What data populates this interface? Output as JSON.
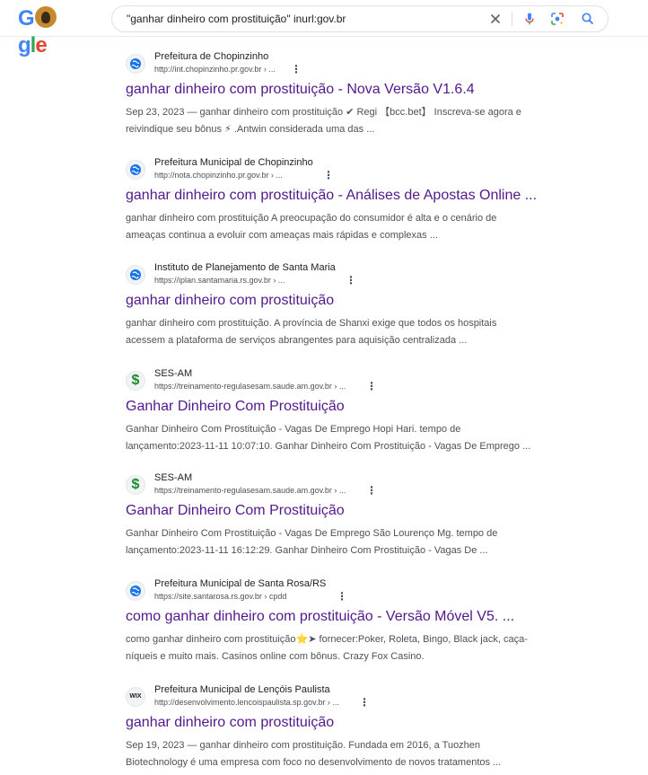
{
  "search": {
    "query": "\"ganhar dinheiro com prostituição\" inurl:gov.br"
  },
  "logo": {
    "text_g1": "G",
    "text_g2": "g",
    "text_l": "l",
    "text_e": "e"
  },
  "icons": {
    "clear": "close-icon",
    "voice": "microphone-icon",
    "lens": "lens-icon",
    "search": "search-icon"
  },
  "colors": {
    "title_link": "#52188c",
    "favicon_globe": "#1a73e8",
    "favicon_dollar": "#198b2c"
  },
  "results": [
    {
      "favicon": "globe",
      "site_name": "Prefeitura de Chopinzinho",
      "url": "http://int.chopinzinho.pr.gov.br › ...",
      "title": "ganhar dinheiro com prostituição - Nova Versão V1.6.4",
      "snippet_line1": "Sep 23, 2023 — ganhar dinheiro com prostituição ✔ Regi 【bcc.bet】 Inscreva-se agora e",
      "snippet_line2": "reivindique seu bônus ⚡ .Antwin considerada uma das ..."
    },
    {
      "favicon": "globe",
      "site_name": "Prefeitura Municipal de Chopinzinho",
      "url": "http://nota.chopinzinho.pr.gov.br › ...",
      "title": "ganhar dinheiro com prostituição - Análises de Apostas Online ...",
      "snippet_line1": "ganhar dinheiro com prostituição A preocupação do consumidor é alta e o cenário de",
      "snippet_line2": "ameaças continua a evoluir com ameaças mais rápidas e complexas ..."
    },
    {
      "favicon": "globe",
      "site_name": "Instituto de Planejamento de Santa Maria",
      "url": "https://iplan.santamaria.rs.gov.br › ...",
      "title": "ganhar dinheiro com prostituição",
      "snippet_line1": "ganhar dinheiro com prostituição. A província de Shanxi exige que todos os hospitais",
      "snippet_line2": "acessem a plataforma de serviços abrangentes para aquisição centralizada ..."
    },
    {
      "favicon": "dollar",
      "site_name": "SES-AM",
      "url": "https://treinamento-regulasesam.saude.am.gov.br › ...",
      "title": "Ganhar Dinheiro Com Prostituição",
      "snippet_line1": "Ganhar Dinheiro Com Prostituição - Vagas De Emprego Hopi Hari. tempo de",
      "snippet_line2": "lançamento:2023-11-11 10:07:10. Ganhar Dinheiro Com Prostituição - Vagas De Emprego ..."
    },
    {
      "favicon": "dollar",
      "site_name": "SES-AM",
      "url": "https://treinamento-regulasesam.saude.am.gov.br › ...",
      "title": "Ganhar Dinheiro Com Prostituição",
      "snippet_line1": "Ganhar Dinheiro Com Prostituição - Vagas De Emprego São Lourenço Mg. tempo de",
      "snippet_line2": "lançamento:2023-11-11 16:12:29. Ganhar Dinheiro Com Prostituição - Vagas De ..."
    },
    {
      "favicon": "globe",
      "site_name": "Prefeitura Municipal de Santa Rosa/RS",
      "url": "https://site.santarosa.rs.gov.br › cpdd",
      "title": "como ganhar dinheiro com prostituição - Versão Móvel V5. ...",
      "snippet_line1": "como ganhar dinheiro com prostituição⭐➤ fornecer:Poker, Roleta, Bingo, Black jack, caça-",
      "snippet_line2": "níqueis e muito mais. Casinos online com bônus. Crazy Fox Casino."
    },
    {
      "favicon": "wix",
      "favicon_text": "WIX",
      "site_name": "Prefeitura Municipal de Lençóis Paulista",
      "url": "http://desenvolvimento.lencoispaulista.sp.gov.br › ...",
      "title": "ganhar dinheiro com prostituição",
      "snippet_line1": "Sep 19, 2023 — ganhar dinheiro com prostituição. Fundada em 2016, a Tuozhen",
      "snippet_line2": "Biotechnology é uma empresa com foco no desenvolvimento de novos tratamentos ..."
    }
  ]
}
